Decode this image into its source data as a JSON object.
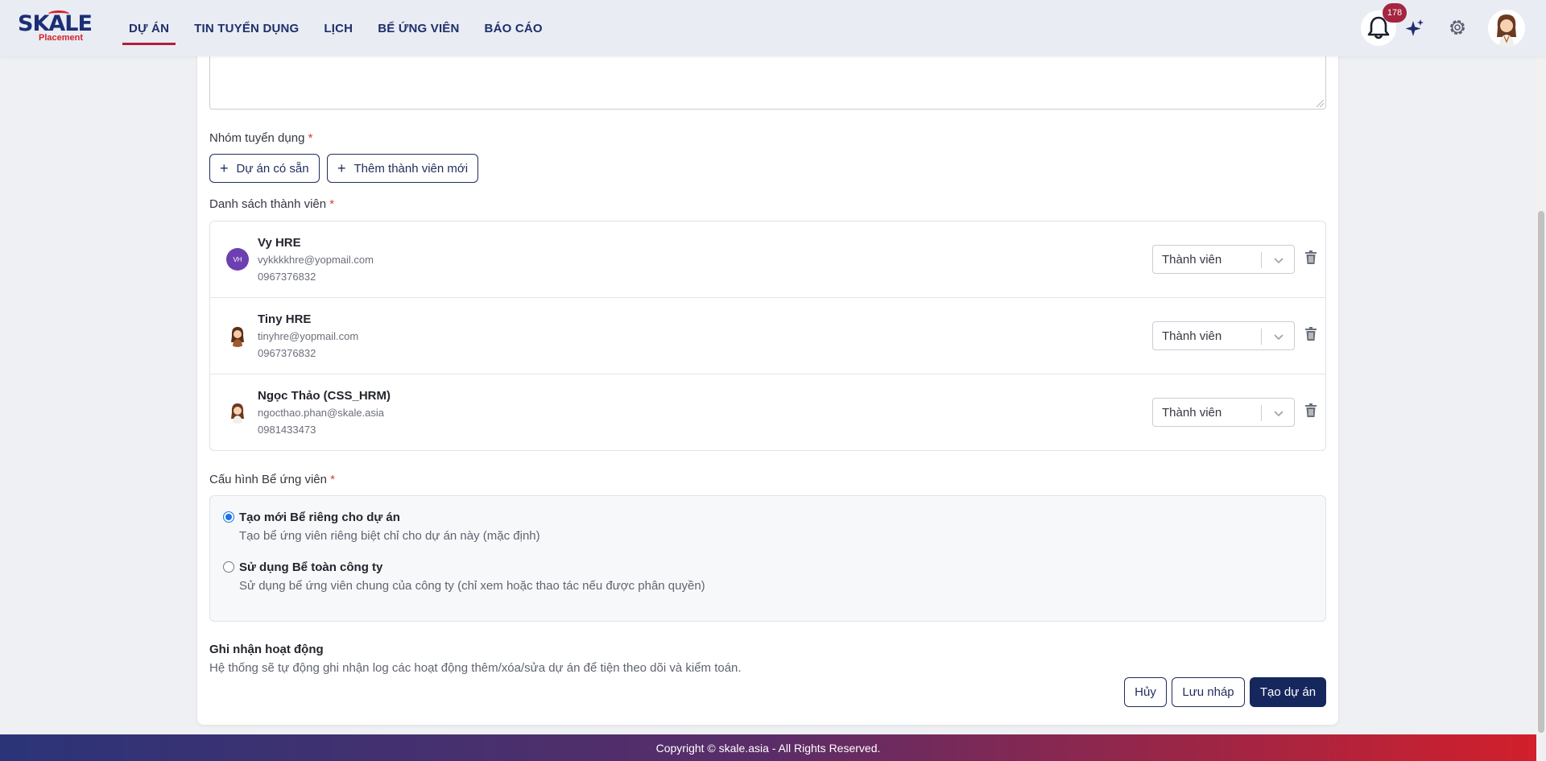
{
  "brand": {
    "name": "SKALE",
    "sub": "Placement"
  },
  "nav": [
    {
      "label": "DỰ ÁN",
      "active": true
    },
    {
      "label": "TIN TUYỂN DỤNG",
      "active": false
    },
    {
      "label": "LỊCH",
      "active": false
    },
    {
      "label": "BỂ ỨNG VIÊN",
      "active": false
    },
    {
      "label": "BÁO CÁO",
      "active": false
    }
  ],
  "notifications": {
    "count": "178"
  },
  "form": {
    "group_label": "Nhóm tuyển dụng",
    "existing_project_button": "Dự án có sẵn",
    "add_member_button": "Thêm thành viên mới",
    "members_label": "Danh sách thành viên",
    "required_mark": "*",
    "members": [
      {
        "initials": "VH",
        "name": "Vy HRE",
        "email": "vykkkkhre@yopmail.com",
        "phone": "0967376832",
        "role": "Thành viên"
      },
      {
        "initials": "",
        "name": "Tiny HRE",
        "email": "tinyhre@yopmail.com",
        "phone": "0967376832",
        "role": "Thành viên"
      },
      {
        "initials": "",
        "name": "Ngọc Thảo (CSS_HRM)",
        "email": "ngocthao.phan@skale.asia",
        "phone": "0981433473",
        "role": "Thành viên"
      }
    ],
    "pool_label": "Cấu hình Bể ứng viên",
    "pool_options": [
      {
        "title": "Tạo mới Bể riêng cho dự án",
        "desc": "Tạo bể ứng viên riêng biệt chỉ cho dự án này (mặc định)",
        "selected": true
      },
      {
        "title": "Sử dụng Bể toàn công ty",
        "desc": "Sử dụng bể ứng viên chung của công ty (chỉ xem hoặc thao tác nếu được phân quyền)",
        "selected": false
      }
    ],
    "log_title": "Ghi nhận hoạt động",
    "log_desc": "Hệ thống sẽ tự động ghi nhận log các hoạt động thêm/xóa/sửa dự án để tiện theo dõi và kiểm toán.",
    "cancel_button": "Hủy",
    "draft_button": "Lưu nháp",
    "create_button": "Tạo dự án"
  },
  "footer": {
    "copyright": "Copyright © skale.asia - All Rights Reserved."
  },
  "colors": {
    "primary": "#16275e",
    "accent": "#a5243f",
    "radio": "#1a73e8"
  }
}
